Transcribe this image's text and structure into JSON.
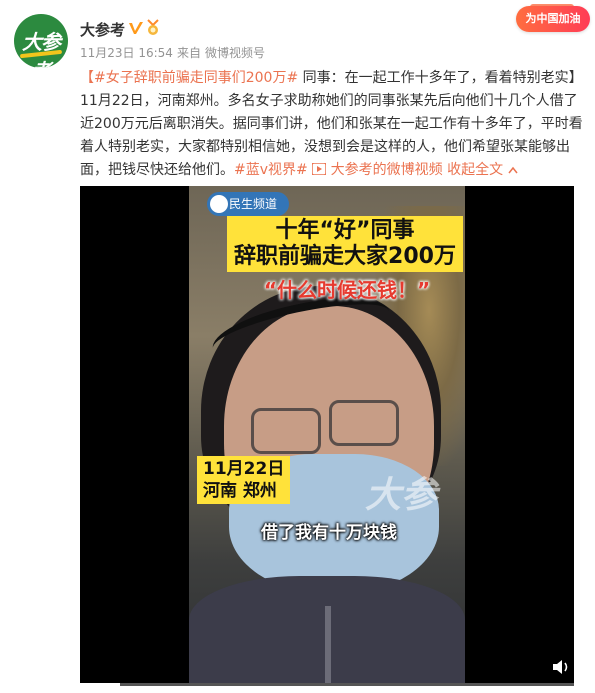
{
  "post": {
    "author": "大参考",
    "avatar_text": "大参考",
    "meta": {
      "date_time": "11月23日 16:54",
      "source_prefix": "来自",
      "source": "微博视频号"
    },
    "campaign_label": "为中国加油",
    "text": {
      "hashtag_title": "【#女子辞职前骗走同事们200万#",
      "intro": " 同事：在一起工作十多年了，看着特别老实】",
      "body": "11月22日，河南郑州。多名女子求助称她们的同事张某先后向他们十几个人借了近200万元后离职消失。据同事们讲，他们和张某在一起工作有十多年了，平时看着人特别老实，大家都特别相信她，没想到会是这样的人，他们希望张某能够出面，把钱尽快还给他们。",
      "hashtag_tail": "#蓝v视界#",
      "video_link": " 大参考的微博视频",
      "collapse": " 收起全文",
      "collapse_icon": "chevron-up-icon"
    }
  },
  "video": {
    "channel_logo": "民生频道",
    "headline_1": "十年“好”同事",
    "headline_2": "辞职前骗走大家200万",
    "subtitle": "“什么时候还钱！”",
    "date_line_1": "11月22日",
    "date_line_2": "河南 郑州",
    "watermark": "大参",
    "caption": "借了我有十万块钱",
    "progress_fraction": 0.08
  },
  "colors": {
    "link": "#eb7350",
    "headline_bg": "#ffe23a",
    "subtitle_red": "#e63a2f",
    "avatar_green": "#2c8a3f"
  }
}
